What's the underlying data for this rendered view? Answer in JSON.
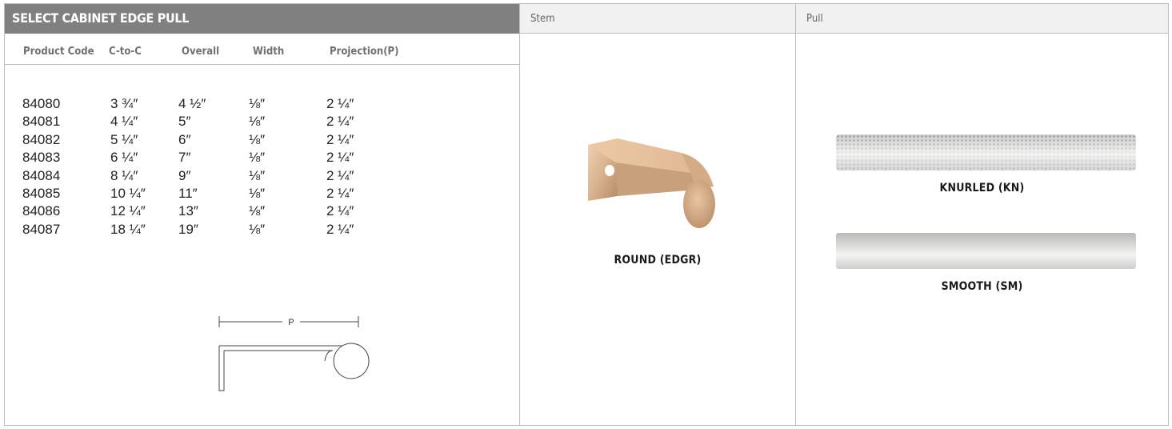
{
  "spec": {
    "title": "SELECT CABINET EDGE PULL",
    "columns": [
      "Product Code",
      "C-to-C",
      "Overall",
      "Width",
      "Projection(P)"
    ],
    "rows": [
      [
        "84080",
        "3 ¾″",
        "4 ½″",
        "⅛″",
        "2 ¼″"
      ],
      [
        "84081",
        "4 ¼″",
        "5″",
        "⅛″",
        "2 ¼″"
      ],
      [
        "84082",
        "5 ¼″",
        "6″",
        "⅛″",
        "2 ¼″"
      ],
      [
        "84083",
        "6 ¼″",
        "7″",
        "⅛″",
        "2 ¼″"
      ],
      [
        "84084",
        "8 ¼″",
        "9″",
        "⅛″",
        "2 ¼″"
      ],
      [
        "84085",
        "10 ¼″",
        "11″",
        "⅛″",
        "2 ¼″"
      ],
      [
        "84086",
        "12 ¼″",
        "13″",
        "⅛″",
        "2 ¼″"
      ],
      [
        "84087",
        "18 ¼″",
        "19″",
        "⅛″",
        "2 ¼″"
      ]
    ],
    "diagram_label": "P"
  },
  "stem": {
    "heading": "Stem",
    "option_label": "ROUND (EDGR)"
  },
  "pull": {
    "heading": "Pull",
    "options": [
      {
        "label": "KNURLED (KN)"
      },
      {
        "label": "SMOOTH (SM)"
      }
    ]
  },
  "colors": {
    "title_bar": "#808080",
    "header_bg": "#f1f1f1",
    "border": "#bdbdbd",
    "stem_finish": "#d9b48f",
    "pull_finish": "#d6d6d4"
  }
}
